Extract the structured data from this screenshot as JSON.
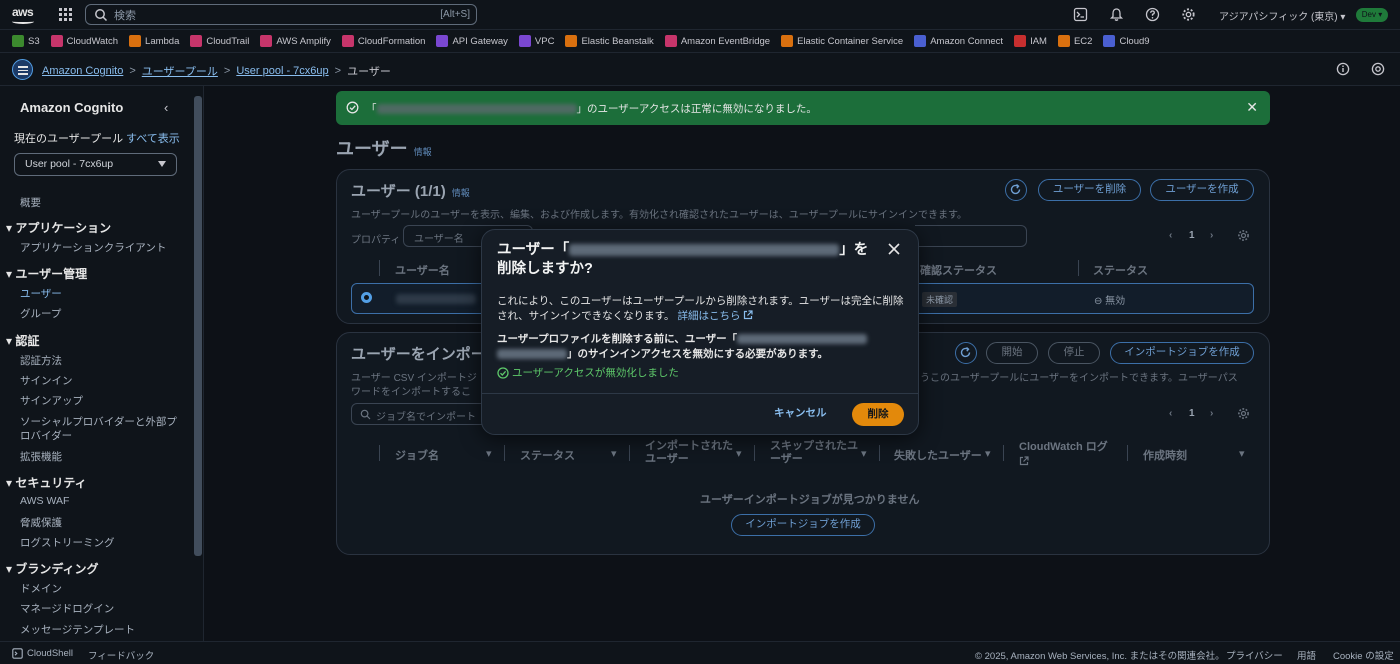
{
  "topbar": {
    "logo": "aws",
    "search_placeholder": "検索",
    "search_shortcut": "[Alt+S]",
    "region": "アジアパシフィック (東京) ▾",
    "account_badge": "Dev ▾"
  },
  "favorites": [
    {
      "label": "S3",
      "color": "#3c8a2e"
    },
    {
      "label": "CloudWatch",
      "color": "#c7356b"
    },
    {
      "label": "Lambda",
      "color": "#d9700f"
    },
    {
      "label": "CloudTrail",
      "color": "#c7356b"
    },
    {
      "label": "AWS Amplify",
      "color": "#c7356b"
    },
    {
      "label": "CloudFormation",
      "color": "#c7356b"
    },
    {
      "label": "API Gateway",
      "color": "#7a47d1"
    },
    {
      "label": "VPC",
      "color": "#7a47d1"
    },
    {
      "label": "Elastic Beanstalk",
      "color": "#d9700f"
    },
    {
      "label": "Amazon EventBridge",
      "color": "#c7356b"
    },
    {
      "label": "Elastic Container Service",
      "color": "#d9700f"
    },
    {
      "label": "Amazon Connect",
      "color": "#4a5fd1"
    },
    {
      "label": "IAM",
      "color": "#c72f2f"
    },
    {
      "label": "EC2",
      "color": "#d9700f"
    },
    {
      "label": "Cloud9",
      "color": "#4a5fd1"
    }
  ],
  "breadcrumb": {
    "items": [
      "Amazon Cognito",
      "ユーザープール",
      "User pool - 7cx6up"
    ],
    "current": "ユーザー"
  },
  "sidebar": {
    "title": "Amazon Cognito",
    "pool_label": "現在のユーザープール",
    "show_all": "すべて表示",
    "pool_select": "User pool - 7cx6up",
    "overview": "概要",
    "sections": [
      {
        "title": "アプリケーション",
        "items": [
          "アプリケーションクライアント"
        ]
      },
      {
        "title": "ユーザー管理",
        "items": [
          "ユーザー",
          "グループ"
        ]
      },
      {
        "title": "認証",
        "items": [
          "認証方法",
          "サインイン",
          "サインアップ",
          "ソーシャルプロバイダーと外部プ",
          "ロバイダー",
          "拡張機能"
        ]
      },
      {
        "title": "セキュリティ",
        "items": [
          "AWS WAF",
          "脅威保護",
          "ログストリーミング"
        ]
      },
      {
        "title": "ブランディング",
        "items": [
          "ドメイン",
          "マネージドログイン",
          "メッセージテンプレート"
        ]
      }
    ],
    "active_item": "ユーザー"
  },
  "flash": {
    "prefix": "「",
    "suffix": "」のユーザーアクセスは正常に無効になりました。"
  },
  "page": {
    "title": "ユーザー",
    "info": "情報"
  },
  "users_panel": {
    "title": "ユーザー (1/1)",
    "info": "情報",
    "description": "ユーザープールのユーザーを表示、編集、および作成します。有効化され確認されたユーザーは、ユーザープールにサインインできます。",
    "delete_button": "ユーザーを削除",
    "create_button": "ユーザーを作成",
    "property_label": "プロパティ",
    "property_value": "ユーザー名",
    "page_number": "1",
    "columns": [
      "ユーザー名",
      "確認ステータス",
      "ステータス"
    ],
    "row": {
      "confirmation": "未確認",
      "status": "無効"
    }
  },
  "import_panel": {
    "title": "ユーザーをインポート",
    "desc_1": "ユーザー CSV インポートジ",
    "desc_1_tail": "うこのユーザープールにユーザーをインポートできます。ユーザーパス",
    "desc_2": "ワードをインポートするこ",
    "start_button": "開始",
    "stop_button": "停止",
    "create_job_button": "インポートジョブを作成",
    "search_placeholder": "ジョブ名でインポート",
    "page_number": "1",
    "columns": [
      "ジョブ名",
      "ステータス",
      "インポートされた ユーザー",
      "スキップされたユ ーザー",
      "失敗したユーザー",
      "CloudWatch ログ",
      "作成時刻"
    ],
    "empty_text": "ユーザーインポートジョブが見つかりません",
    "empty_button": "インポートジョブを作成"
  },
  "modal": {
    "title_prefix": "ユーザー「",
    "title_suffix": "」を",
    "title_line2": "削除しますか?",
    "body_1": "これにより、このユーザーはユーザープールから削除されます。ユーザーは完全に削除され、サインインできなくなります。",
    "details_link": "詳細はこちら",
    "body_2_prefix": "ユーザープロファイルを削除する前に、ユーザー「",
    "body_2_suffix": "」のサインインアクセスを無効にする必要があります。",
    "success": "ユーザーアクセスが無効化しました",
    "cancel": "キャンセル",
    "delete": "削除"
  },
  "footer": {
    "cloudshell": "CloudShell",
    "feedback": "フィードバック",
    "copyright": "© 2025, Amazon Web Services, Inc. またはその関連会社。",
    "privacy": "プライバシー",
    "terms": "用語",
    "cookie": "Cookie の設定"
  }
}
